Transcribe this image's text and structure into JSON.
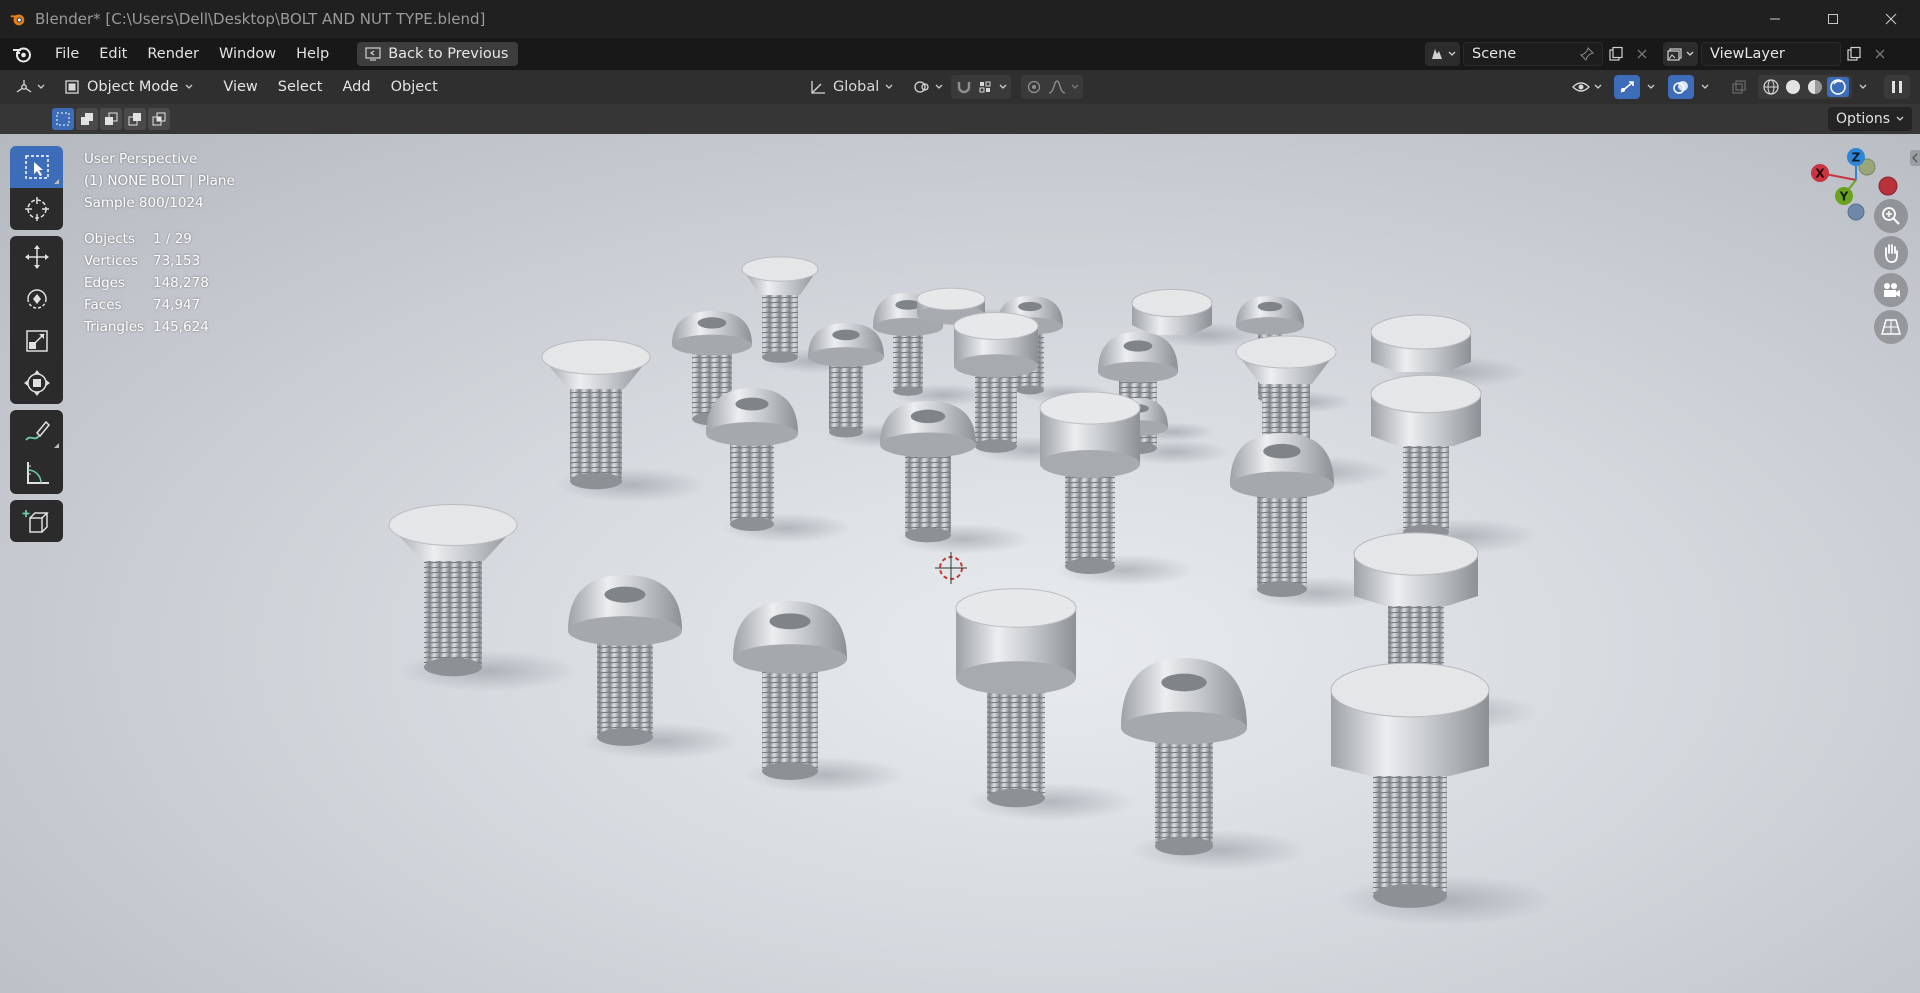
{
  "window": {
    "title": "Blender* [C:\\Users\\Dell\\Desktop\\BOLT AND NUT TYPE.blend]",
    "controls": [
      "minimize",
      "maximize",
      "close"
    ]
  },
  "menubar": {
    "items": [
      "File",
      "Edit",
      "Render",
      "Window",
      "Help"
    ],
    "back_button": "Back to Previous",
    "scene_name": "Scene",
    "view_layer_name": "ViewLayer"
  },
  "header": {
    "mode": "Object Mode",
    "menus": [
      "View",
      "Select",
      "Add",
      "Object"
    ],
    "transform_orientation": "Global"
  },
  "toolsettings": {
    "options_label": "Options"
  },
  "viewport": {
    "view_name": "User Perspective",
    "active_object": "(1) NONE BOLT | Plane",
    "sample": "Sample 800/1024",
    "stats": [
      {
        "label": "Objects",
        "value": "1 / 29"
      },
      {
        "label": "Vertices",
        "value": "73,153"
      },
      {
        "label": "Edges",
        "value": "148,278"
      },
      {
        "label": "Faces",
        "value": "74,947"
      },
      {
        "label": "Triangles",
        "value": "145,624"
      }
    ],
    "gizmo_axes": {
      "z": "Z",
      "x": "X",
      "y": "Y"
    }
  },
  "colors": {
    "accent": "#3d6db8",
    "axis_x": "#c8343f",
    "axis_y": "#6ba31f",
    "axis_z": "#2f86d6"
  }
}
